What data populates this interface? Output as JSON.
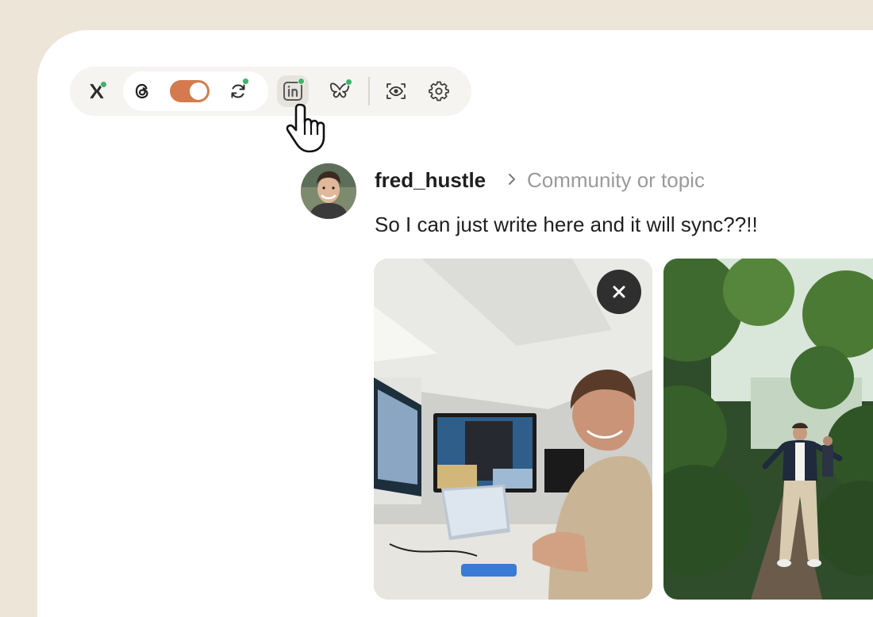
{
  "toolbar": {
    "buttons": [
      {
        "id": "x",
        "icon": "x-logo-icon",
        "connected": true
      },
      {
        "id": "threads",
        "icon": "threads-logo-icon",
        "connected": false
      },
      {
        "id": "toggle",
        "icon": "toggle-switch",
        "state": "on"
      },
      {
        "id": "sync",
        "icon": "sync-icon",
        "connected": true
      },
      {
        "id": "linkedin",
        "icon": "linkedin-logo-icon",
        "connected": true,
        "hovered": true
      },
      {
        "id": "bluesky",
        "icon": "bluesky-butterfly-icon",
        "connected": true
      },
      {
        "id": "preview",
        "icon": "eye-preview-icon"
      },
      {
        "id": "settings",
        "icon": "gear-icon"
      }
    ]
  },
  "post": {
    "username": "fred_hustle",
    "community_placeholder": "Community or topic",
    "text": "So I can just write here and it will sync??!!"
  },
  "colors": {
    "background": "#ede5d7",
    "toggle_accent": "#d47a4e",
    "status_dot": "#3db56b"
  }
}
